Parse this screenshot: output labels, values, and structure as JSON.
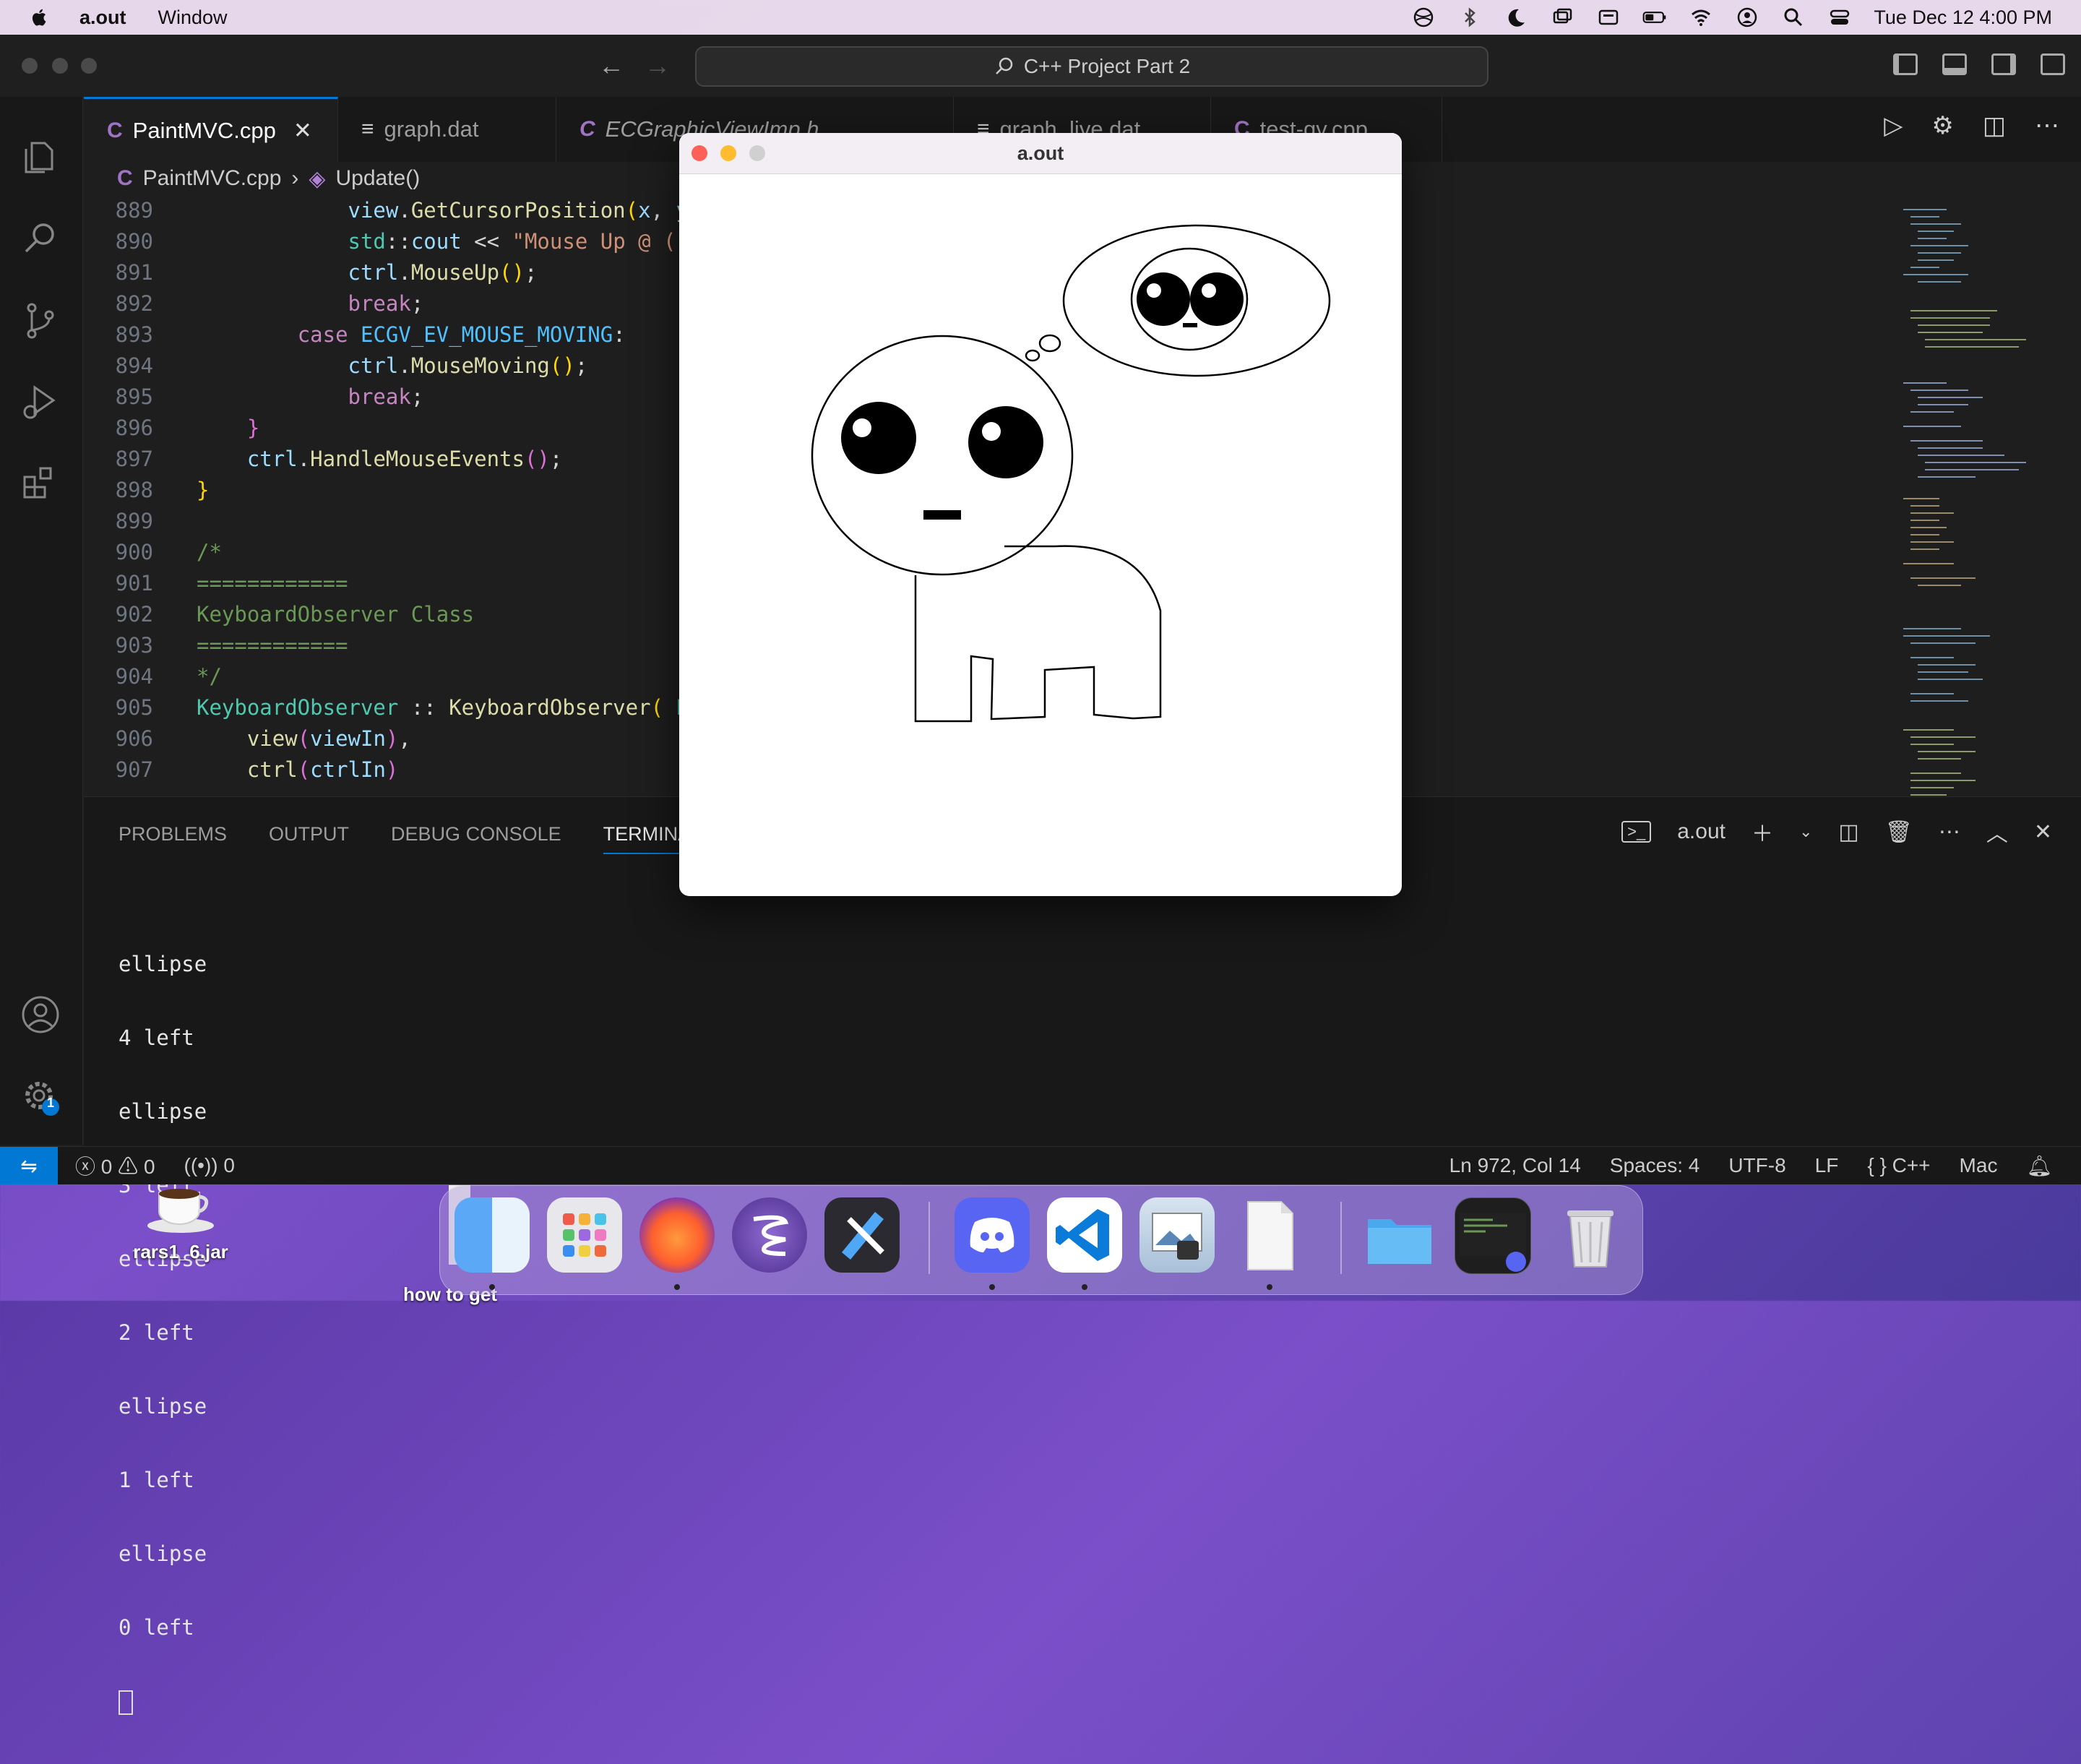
{
  "menubar": {
    "app_name": "a.out",
    "menu_window": "Window",
    "datetime": "Tue Dec 12  4:00 PM"
  },
  "vscode": {
    "command_center": "C++ Project Part 2",
    "tabs": [
      {
        "label": "PaintMVC.cpp",
        "icon": "cpp-file-icon",
        "active": true
      },
      {
        "label": "graph.dat",
        "icon": "list-file-icon"
      },
      {
        "label": "ECGraphicViewImp.h",
        "icon": "c-header-file-icon"
      },
      {
        "label": "graph_live.dat",
        "icon": "list-file-icon"
      },
      {
        "label": "test-gv.cpp",
        "icon": "cpp-file-icon"
      }
    ],
    "breadcrumb": {
      "file": "PaintMVC.cpp",
      "symbol": "Update()"
    },
    "code_lines": [
      {
        "n": "889",
        "text": "view.GetCursorPosition(x, y"
      },
      {
        "n": "890",
        "text": "std::cout << \"Mouse Up @ (\""
      },
      {
        "n": "891",
        "text": "ctrl.MouseUp();"
      },
      {
        "n": "892",
        "text": "break;"
      },
      {
        "n": "893",
        "text": "case ECGV_EV_MOUSE_MOVING:"
      },
      {
        "n": "894",
        "text": "ctrl.MouseMoving();"
      },
      {
        "n": "895",
        "text": "break;"
      },
      {
        "n": "896",
        "text": "}"
      },
      {
        "n": "897",
        "text": "ctrl.HandleMouseEvents();"
      },
      {
        "n": "898",
        "text": "}"
      },
      {
        "n": "899",
        "text": ""
      },
      {
        "n": "900",
        "text": "/*"
      },
      {
        "n": "901",
        "text": "============"
      },
      {
        "n": "902",
        "text": "KeyboardObserver Class"
      },
      {
        "n": "903",
        "text": "============"
      },
      {
        "n": "904",
        "text": "*/"
      },
      {
        "n": "905",
        "text": "KeyboardObserver :: KeyboardObserver( E"
      },
      {
        "n": "906",
        "text": "view(viewIn),"
      },
      {
        "n": "907",
        "text": "ctrl(ctrlIn)"
      }
    ],
    "panel": {
      "tabs": [
        "PROBLEMS",
        "OUTPUT",
        "DEBUG CONSOLE",
        "TERMINAL"
      ],
      "active_tab": "TERMINAL",
      "terminal_name": "a.out",
      "terminal_lines": [
        "ellipse",
        "4 left",
        "ellipse",
        "3 left",
        "ellipse",
        "2 left",
        "ellipse",
        "1 left",
        "ellipse",
        "0 left"
      ]
    },
    "statusbar": {
      "errors": "0",
      "warnings": "0",
      "ports": "0",
      "position": "Ln 972, Col 14",
      "spaces": "Spaces: 4",
      "encoding": "UTF-8",
      "eol": "LF",
      "language": "C++",
      "platform": "Mac"
    },
    "settings_badge": "1"
  },
  "aout_window": {
    "title": "a.out"
  },
  "desktop": {
    "icons": [
      {
        "label": "rars1_6.jar",
        "icon": "java-coffee-icon"
      },
      {
        "label": "how to get",
        "icon": "document-icon"
      }
    ]
  },
  "dock": {
    "apps": [
      {
        "name": "finder-icon",
        "color": "#3d9bf0",
        "running": true
      },
      {
        "name": "launchpad-icon",
        "color": "#e8e8ec",
        "running": false
      },
      {
        "name": "firefox-icon",
        "color": "#ff7139",
        "running": true
      },
      {
        "name": "emacs-icon",
        "color": "#7b5ac0",
        "running": false
      },
      {
        "name": "xcode-icon",
        "color": "#2a2a2a",
        "running": false
      },
      {
        "name": "discord-icon",
        "color": "#5865f2",
        "running": true
      },
      {
        "name": "vscode-icon",
        "color": "#0a7bd8",
        "running": true
      },
      {
        "name": "preview-icon",
        "color": "#c9d7e6",
        "running": false
      },
      {
        "name": "textedit-icon",
        "color": "#f4f4f4",
        "running": true
      },
      {
        "name": "folder-icon",
        "color": "#4aa8ec",
        "running": false
      },
      {
        "name": "window-preview-icon",
        "color": "#1e1e1e",
        "running": false
      },
      {
        "name": "trash-icon",
        "color": "#d8d8dc",
        "running": false
      }
    ]
  }
}
